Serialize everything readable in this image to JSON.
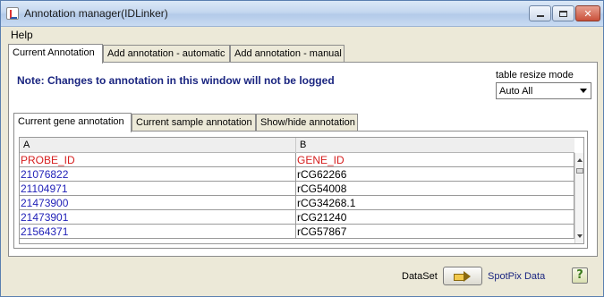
{
  "window": {
    "title": "Annotation manager(IDLinker)"
  },
  "menubar": {
    "help": "Help"
  },
  "tabs": [
    {
      "label": "Current Annotation"
    },
    {
      "label": "Add annotation - automatic"
    },
    {
      "label": "Add annotation - manual"
    }
  ],
  "note": "Note: Changes to annotation in this window will not be logged",
  "table_resize": {
    "label": "table resize mode",
    "value": "Auto All"
  },
  "subtabs": [
    {
      "label": "Current gene annotation"
    },
    {
      "label": "Current sample annotation"
    },
    {
      "label": "Show/hide annotation"
    }
  ],
  "table": {
    "columns": [
      "A",
      "B"
    ],
    "rows": [
      [
        "PROBE_ID",
        "GENE_ID"
      ],
      [
        "21076822",
        "rCG62266"
      ],
      [
        "21104971",
        "rCG54008"
      ],
      [
        "21473900",
        "rCG34268.1"
      ],
      [
        "21473901",
        "rCG21240"
      ],
      [
        "21564371",
        "rCG57867"
      ]
    ]
  },
  "footer": {
    "dataset_label": "DataSet",
    "dataset_name": "SpotPix Data",
    "help_symbol": "?"
  },
  "icons": [
    "app-icon",
    "minimize-icon",
    "maximize-icon",
    "close-icon",
    "dropdown-arrow-icon",
    "scroll-up-icon",
    "scroll-down-icon",
    "arrow-right-icon",
    "help-icon"
  ]
}
